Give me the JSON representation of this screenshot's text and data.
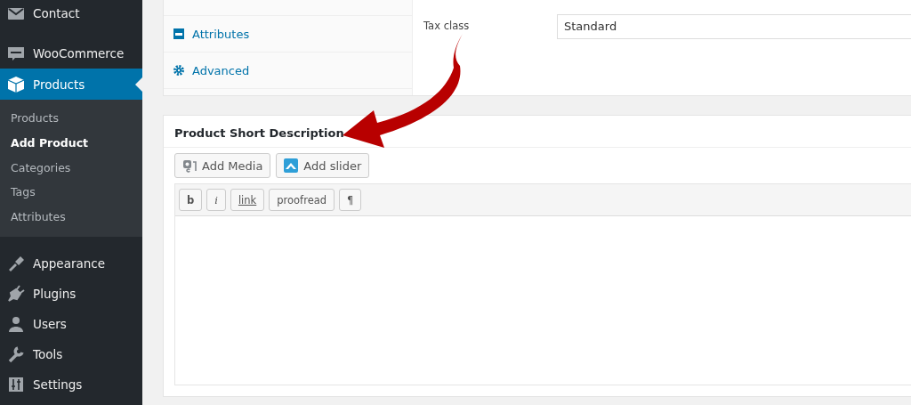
{
  "sidebar": {
    "items": [
      {
        "label": "Contact",
        "selected": false
      },
      {
        "label": "WooCommerce",
        "selected": false
      },
      {
        "label": "Products",
        "selected": true
      }
    ],
    "submenu": [
      {
        "label": "Products",
        "selected": false
      },
      {
        "label": "Add Product",
        "selected": true
      },
      {
        "label": "Categories",
        "selected": false
      },
      {
        "label": "Tags",
        "selected": false
      },
      {
        "label": "Attributes",
        "selected": false
      }
    ],
    "lower_items": [
      {
        "label": "Appearance",
        "selected": false
      },
      {
        "label": "Plugins",
        "selected": false
      },
      {
        "label": "Users",
        "selected": false
      },
      {
        "label": "Tools",
        "selected": false
      },
      {
        "label": "Settings",
        "selected": false
      }
    ]
  },
  "product_data": {
    "tabs": [
      {
        "label": "Attributes",
        "selected": false
      },
      {
        "label": "Advanced",
        "selected": false
      }
    ],
    "tax_class": {
      "label": "Tax class",
      "value": "Standard"
    }
  },
  "short_description": {
    "title": "Product Short Description",
    "media_buttons": [
      "Add Media",
      "Add slider"
    ],
    "quicktags": [
      "b",
      "i",
      "link",
      "proofread",
      "¶"
    ]
  }
}
